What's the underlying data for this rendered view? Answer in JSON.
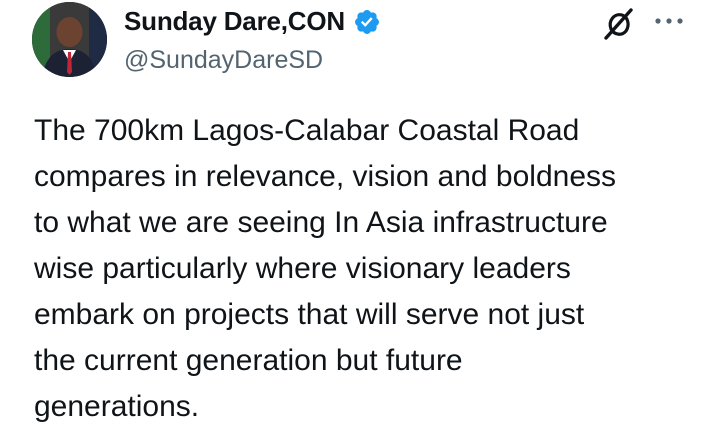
{
  "author": {
    "display_name": "Sunday Dare,CON",
    "handle": "@SundayDareSD",
    "verified": true
  },
  "icons": {
    "verified": "verified-badge-icon",
    "grok": "grok-icon",
    "more": "more-options-icon"
  },
  "colors": {
    "verified_blue": "#1d9bf0",
    "text_primary": "#0f1419",
    "text_secondary": "#536471"
  },
  "tweet": {
    "text": "The 700km Lagos-Calabar Coastal Road\ncompares in relevance, vision and boldness\nto what we are seeing In Asia infrastructure\nwise particularly where visionary leaders\nembark on projects that will serve not just\nthe current generation but future\ngenerations."
  }
}
